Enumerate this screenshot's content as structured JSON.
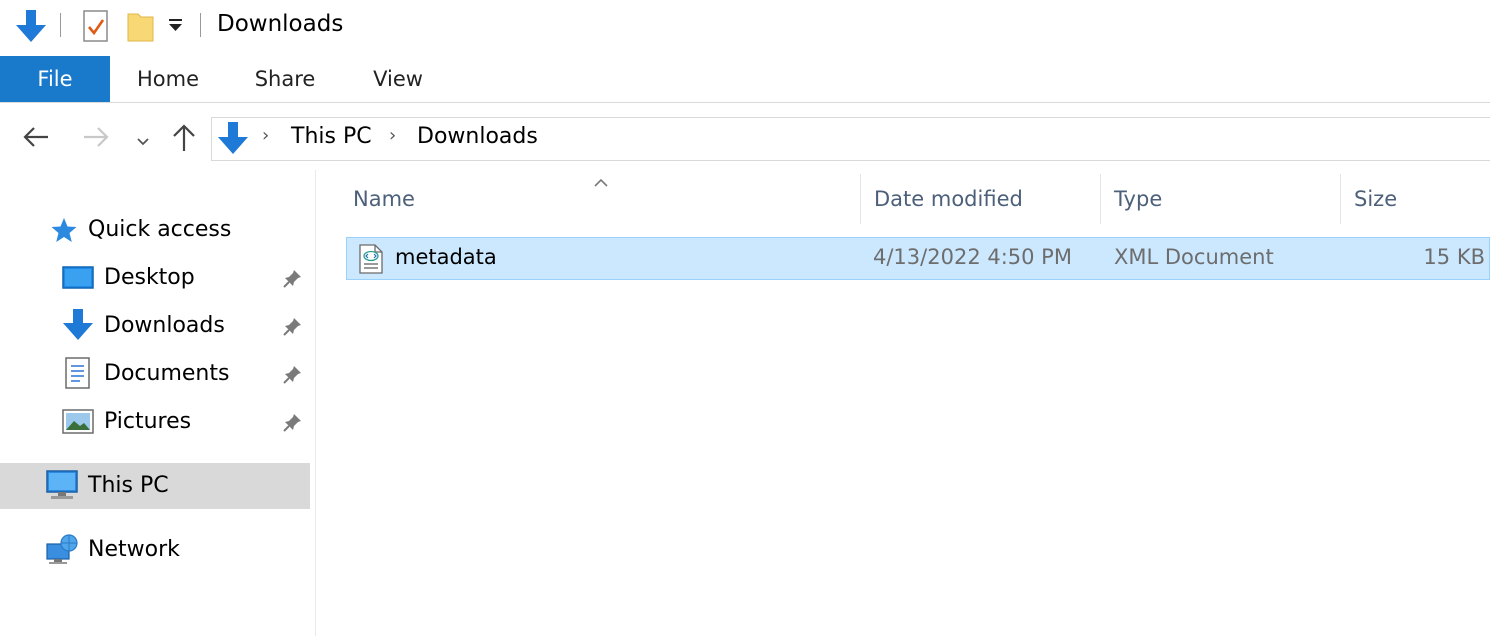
{
  "titlebar": {
    "title": "Downloads",
    "icons": [
      "download-arrow-icon",
      "properties-icon",
      "new-folder-icon",
      "customize-dropdown-icon"
    ]
  },
  "ribbon": {
    "tabs": [
      {
        "label": "File"
      },
      {
        "label": "Home"
      },
      {
        "label": "Share"
      },
      {
        "label": "View"
      }
    ]
  },
  "navbar": {
    "buttons": [
      "back-arrow-icon",
      "forward-arrow-icon",
      "recent-chevron-icon",
      "up-arrow-icon"
    ],
    "breadcrumb": [
      {
        "label": "This PC"
      },
      {
        "label": "Downloads"
      }
    ]
  },
  "navpane": {
    "items": [
      {
        "label": "Quick access",
        "icon": "star-icon"
      },
      {
        "label": "Desktop",
        "icon": "desktop-icon",
        "pinned": true
      },
      {
        "label": "Downloads",
        "icon": "download-arrow-icon",
        "pinned": true
      },
      {
        "label": "Documents",
        "icon": "documents-icon",
        "pinned": true
      },
      {
        "label": "Pictures",
        "icon": "pictures-icon",
        "pinned": true
      },
      {
        "label": "This PC",
        "icon": "computer-icon",
        "selected": true
      },
      {
        "label": "Network",
        "icon": "network-icon"
      }
    ]
  },
  "filelist": {
    "columns": [
      {
        "label": "Name"
      },
      {
        "label": "Date modified"
      },
      {
        "label": "Type"
      },
      {
        "label": "Size"
      }
    ],
    "rows": [
      {
        "name": "metadata",
        "date_modified": "4/13/2022 4:50 PM",
        "type": "XML Document",
        "size": "15 KB",
        "icon": "xml-file-icon",
        "selected": true
      }
    ]
  },
  "colors": {
    "accent": "#1979ca",
    "selection_fill": "#cce8ff",
    "selection_border": "#99d1ff",
    "nav_selected": "#d9d9d9",
    "header_text": "#4c607a"
  }
}
